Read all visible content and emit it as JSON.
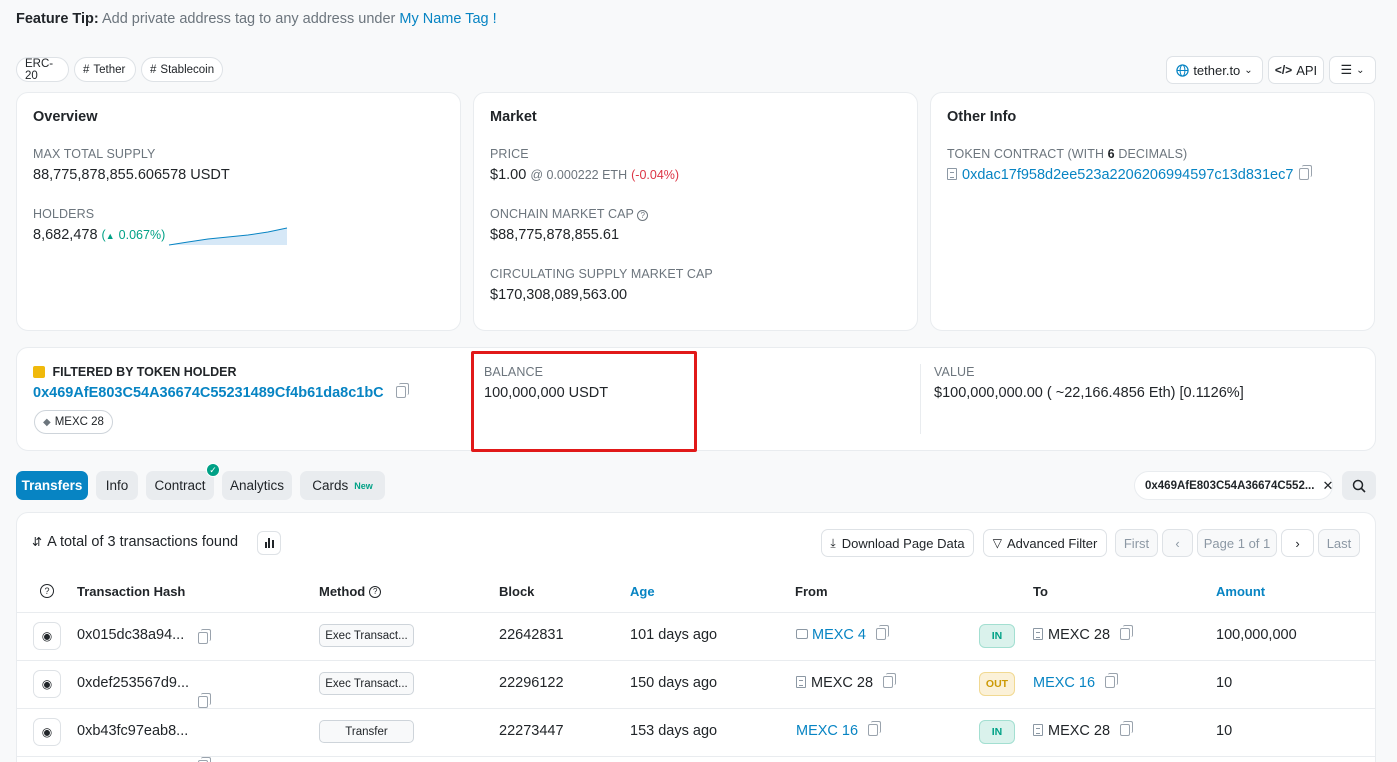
{
  "feature_tip": {
    "label": "Feature Tip:",
    "text": "Add private address tag to any address under",
    "link": "My Name Tag !"
  },
  "tags": [
    "ERC-20",
    "Tether",
    "Stablecoin"
  ],
  "top_buttons": {
    "website": "tether.to",
    "api": "API"
  },
  "overview": {
    "title": "Overview",
    "max_supply_label": "MAX TOTAL SUPPLY",
    "max_supply": "88,775,878,855.606578 USDT",
    "holders_label": "HOLDERS",
    "holders": "8,682,478",
    "holders_change": "0.067%)",
    "holders_change_open": "("
  },
  "market": {
    "title": "Market",
    "price_label": "PRICE",
    "price": "$1.00",
    "price_eth": "@ 0.000222 ETH",
    "price_change": "(-0.04%)",
    "onchain_label": "ONCHAIN MARKET CAP",
    "onchain": "$88,775,878,855.61",
    "circ_label": "CIRCULATING SUPPLY MARKET CAP",
    "circ": "$170,308,089,563.00"
  },
  "other_info": {
    "title": "Other Info",
    "contract_label_pre": "TOKEN CONTRACT (WITH",
    "decimals": "6",
    "contract_label_post": "DECIMALS)",
    "contract": "0xdac17f958d2ee523a2206206994597c13d831ec7"
  },
  "filter": {
    "label": "FILTERED BY TOKEN HOLDER",
    "address": "0x469AfE803C54A36674C55231489Cf4b61da8c1bC",
    "tag": "MEXC 28",
    "balance_label": "BALANCE",
    "balance": "100,000,000 USDT",
    "value_label": "VALUE",
    "value": "$100,000,000.00 ( ~22,166.4856 Eth) [0.1126%]"
  },
  "tabs": [
    "Transfers",
    "Info",
    "Contract",
    "Analytics",
    "Cards"
  ],
  "tab_new_badge": "New",
  "search_chip": "0x469AfE803C54A36674C552...",
  "summary": "A total of 3 transactions found",
  "toolbar": {
    "download": "Download Page Data",
    "advanced": "Advanced Filter",
    "first": "First",
    "page": "Page 1 of 1",
    "last": "Last"
  },
  "columns": {
    "hash": "Transaction Hash",
    "method": "Method",
    "block": "Block",
    "age": "Age",
    "from": "From",
    "to": "To",
    "amount": "Amount"
  },
  "rows": [
    {
      "hash": "0x015dc38a94...",
      "method": "Exec Transact...",
      "block": "22642831",
      "age": "101 days ago",
      "from": "MEXC 4",
      "dir": "IN",
      "to": "MEXC 28",
      "amount": "100,000,000"
    },
    {
      "hash": "0xdef253567d9...",
      "method": "Exec Transact...",
      "block": "22296122",
      "age": "150 days ago",
      "from": "MEXC 28",
      "dir": "OUT",
      "to": "MEXC 16",
      "amount": "10"
    },
    {
      "hash": "0xb43fc97eab8...",
      "method": "Transfer",
      "block": "22273447",
      "age": "153 days ago",
      "from": "MEXC 16",
      "dir": "IN",
      "to": "MEXC 28",
      "amount": "10"
    }
  ],
  "colors": {
    "link": "#0784c3",
    "highlight": "#e11919",
    "in": "#00a186",
    "out": "#cc9a06"
  }
}
